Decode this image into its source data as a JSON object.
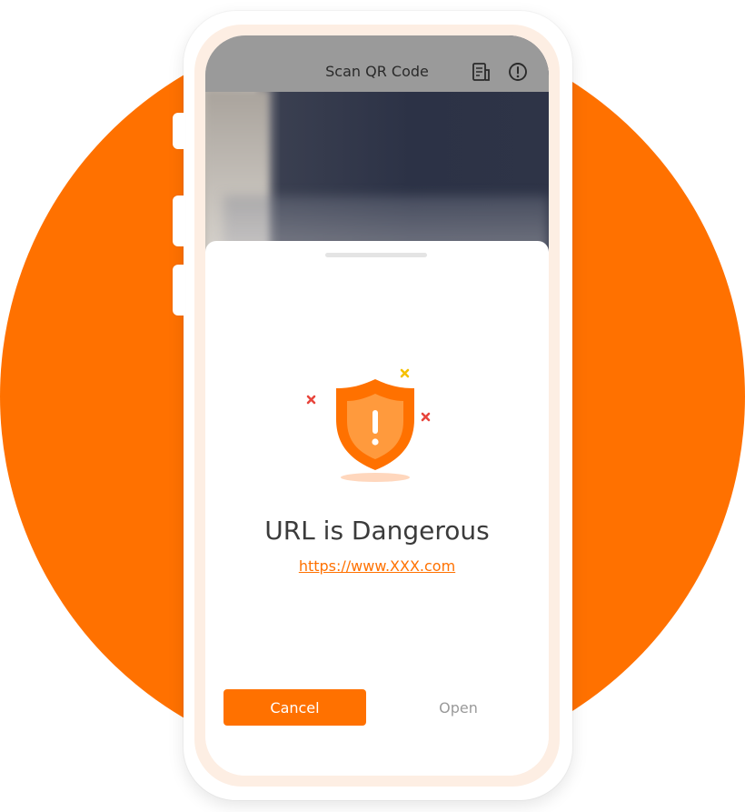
{
  "header": {
    "title": "Scan QR Code",
    "history_icon": "history-list-icon",
    "info_icon": "info-icon"
  },
  "result": {
    "title": "URL is Dangerous",
    "url": "https://www.XXX.com",
    "status_icon": "warning-shield-icon"
  },
  "actions": {
    "cancel_label": "Cancel",
    "open_label": "Open"
  },
  "colors": {
    "accent": "#ff7100",
    "danger_mark": "#e8453c",
    "warning_mark": "#f5c000",
    "muted_text": "#9a9a9a"
  }
}
